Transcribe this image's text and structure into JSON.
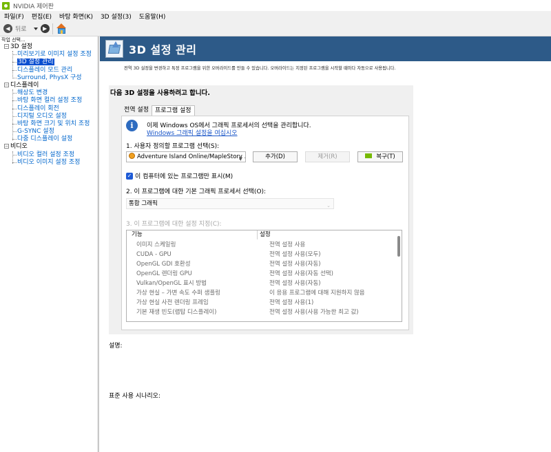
{
  "window": {
    "title": "NVIDIA 제어판"
  },
  "menu": [
    "파일(F)",
    "편집(E)",
    "바탕 화면(K)",
    "3D 설정(3)",
    "도움말(H)"
  ],
  "toolbar": {
    "back_label": "뒤로"
  },
  "sidebar": {
    "header": "작업 선택...",
    "categories": [
      {
        "label": "3D 설정",
        "items": [
          "미리보기로 이미지 설정 조정",
          "3D 설정 관리",
          "디스플레이 모드 관리",
          "Surround, PhysX 구성"
        ]
      },
      {
        "label": "디스플레이",
        "items": [
          "해상도 변경",
          "바탕 화면 컬러 설정 조정",
          "디스플레이 회전",
          "디지털 오디오 설정",
          "바탕 화면 크기 및 위치 조정",
          "G-SYNC 설정",
          "다중 디스플레이 설정"
        ]
      },
      {
        "label": "비디오",
        "items": [
          "비디오 컬러 설정 조정",
          "비디오 이미지 설정 조정"
        ]
      }
    ],
    "selected": "3D 설정 관리"
  },
  "page": {
    "title": "3D 설정 관리",
    "description": "전역 3D 설정을 변경하고 특정 프로그램을 위한 오버라이드를 만들 수 있습니다. 오버라이드는 지정된 프로그램을 시작할 때마다 자동으로 사용됩니다.",
    "panel_heading": "다음 3D 설정을 사용하려고 합니다.",
    "tabs": [
      "전역 설정",
      "프로그램 설정"
    ],
    "active_tab": "프로그램 설정",
    "info_text": "이제 Windows OS에서 그래픽 프로세서의 선택을 관리합니다.",
    "info_link": "Windows 그래픽 설정을 여십시오",
    "step1_label": "1. 사용자 정의할 프로그램 선택(S):",
    "program_value": "Adventure Island Online/MapleStory ...",
    "add_button": "추가(D)",
    "remove_button": "제거(R)",
    "restore_button": "복구(T)",
    "show_only_label": "이 컴퓨터에 있는 프로그램만 표시(M)",
    "step2_label": "2. 이 프로그램에 대한 기본 그래픽 프로세서 선택(O):",
    "gpu_value": "통합 그래픽",
    "step3_label": "3. 이 프로그램에 대한 설정 지정(C):",
    "grid_headers": {
      "feature": "기능",
      "setting": "설정"
    },
    "grid_rows": [
      {
        "feature": "이미지 스케일링",
        "setting": "전역 설정 사용"
      },
      {
        "feature": "CUDA - GPU",
        "setting": "전역 설정 사용(모두)"
      },
      {
        "feature": "OpenGL GDI 호환성",
        "setting": "전역 설정 사용(자동)"
      },
      {
        "feature": "OpenGL 렌더링 GPU",
        "setting": "전역 설정 사용(자동 선택)"
      },
      {
        "feature": "Vulkan/OpenGL 표시 방법",
        "setting": "전역 설정 사용(자동)"
      },
      {
        "feature": "가상 현실 – 가변 속도 수퍼 샘플링",
        "setting": "이 응용 프로그램에 대해 지원하지 않음"
      },
      {
        "feature": "가상 현실 사전 렌더링 프레임",
        "setting": "전역 설정 사용(1)"
      },
      {
        "feature": "기본 재생 빈도(랩탑 디스플레이)",
        "setting": "전역 설정 사용(사용 가능한 최고 값)"
      }
    ],
    "explain_label": "설명:",
    "scenario_label": "표준 사용 시나리오:"
  }
}
